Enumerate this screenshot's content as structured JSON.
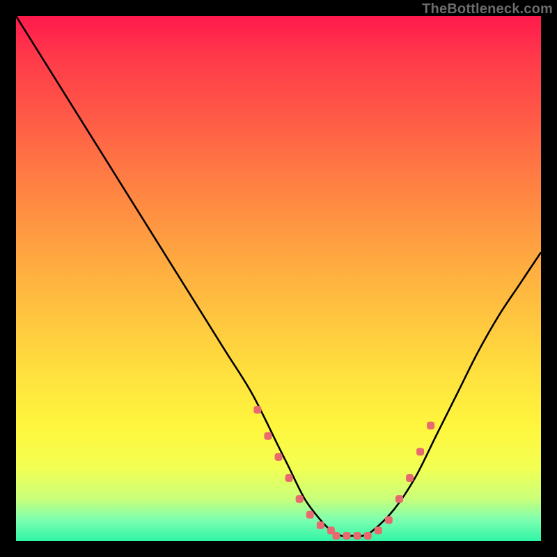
{
  "watermark": "TheBottleneck.com",
  "colors": {
    "background": "#000000",
    "curve_stroke": "#000000",
    "marker_fill": "#e86a6f",
    "gradient_top": "#ff1a4d",
    "gradient_bottom": "#30f4a6"
  },
  "chart_data": {
    "type": "line",
    "title": "",
    "xlabel": "",
    "ylabel": "",
    "xlim": [
      0,
      100
    ],
    "ylim": [
      0,
      100
    ],
    "grid": false,
    "series": [
      {
        "name": "bottleneck-curve",
        "x": [
          0,
          5,
          10,
          15,
          20,
          25,
          30,
          35,
          40,
          45,
          50,
          52,
          55,
          58,
          60,
          62,
          64,
          66,
          68,
          72,
          76,
          80,
          84,
          88,
          92,
          96,
          100
        ],
        "values": [
          100,
          92,
          84,
          76,
          68,
          60,
          52,
          44,
          36,
          28,
          18,
          14,
          8,
          4,
          2,
          1,
          1,
          1,
          2,
          6,
          12,
          20,
          28,
          36,
          43,
          49,
          55
        ]
      }
    ],
    "markers": {
      "name": "highlighted-points",
      "x": [
        46,
        48,
        50,
        52,
        54,
        56,
        58,
        60,
        61,
        63,
        65,
        67,
        69,
        71,
        73,
        75,
        77,
        79
      ],
      "values": [
        25,
        20,
        16,
        12,
        8,
        5,
        3,
        2,
        1,
        1,
        1,
        1,
        2,
        4,
        8,
        12,
        17,
        22
      ]
    }
  }
}
